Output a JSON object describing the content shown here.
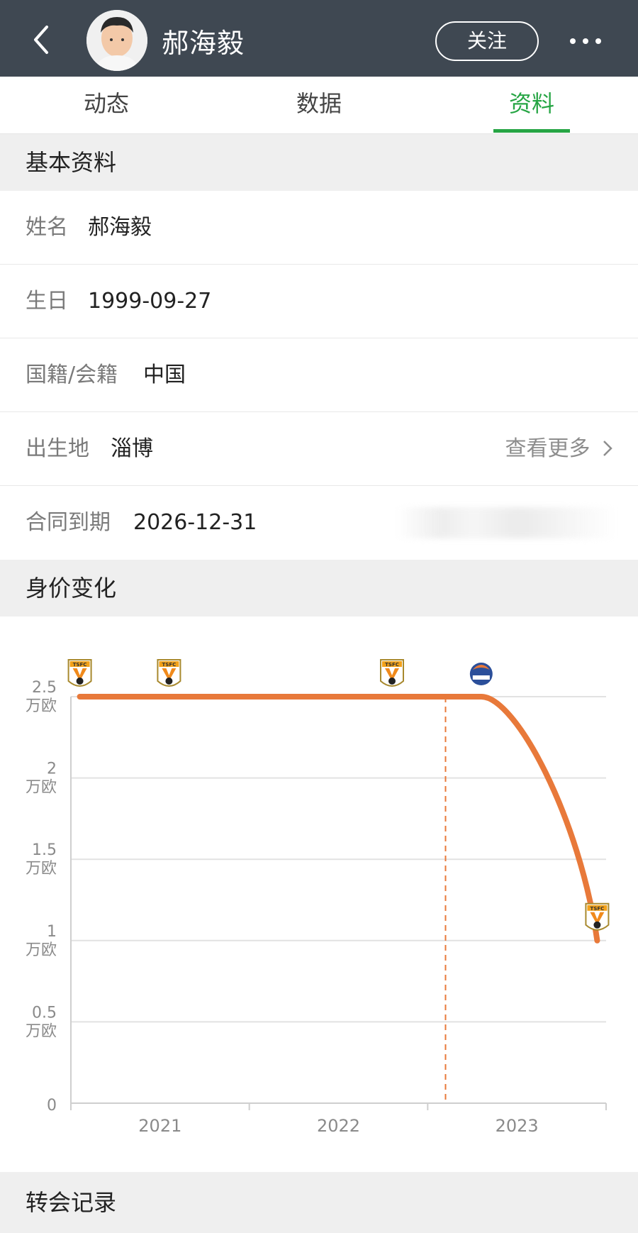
{
  "header": {
    "player_name": "郝海毅",
    "follow_label": "关注"
  },
  "tabs": [
    {
      "label": "动态",
      "active": false
    },
    {
      "label": "数据",
      "active": false
    },
    {
      "label": "资料",
      "active": true
    }
  ],
  "basic_info": {
    "title": "基本资料",
    "rows": [
      {
        "label": "姓名",
        "value": "郝海毅"
      },
      {
        "label": "生日",
        "value": "1999-09-27"
      },
      {
        "label": "国籍/会籍",
        "value": "中国"
      },
      {
        "label": "出生地",
        "value": "淄博",
        "link": "查看更多"
      },
      {
        "label": "合同到期",
        "value": "2026-12-31"
      }
    ]
  },
  "market_value": {
    "title": "身价变化"
  },
  "transfer": {
    "title": "转会记录"
  },
  "colors": {
    "topbar": "#3f4852",
    "accent_green": "#26a544",
    "line_orange": "#e8793a"
  },
  "chart_data": {
    "type": "line",
    "y_ticks": [
      {
        "value": 0,
        "label": "0",
        "unit": ""
      },
      {
        "value": 0.5,
        "label": "0.5",
        "unit": "万欧"
      },
      {
        "value": 1,
        "label": "1",
        "unit": "万欧"
      },
      {
        "value": 1.5,
        "label": "1.5",
        "unit": "万欧"
      },
      {
        "value": 2,
        "label": "2",
        "unit": "万欧"
      },
      {
        "value": 2.5,
        "label": "2.5",
        "unit": "万欧"
      }
    ],
    "x_ticks": [
      "2021",
      "2022",
      "2023"
    ],
    "x_range": [
      2020.5,
      2023.5
    ],
    "ylim": [
      0,
      2.5
    ],
    "series": [
      {
        "values": [
          {
            "x": 2020.55,
            "y": 2.5
          },
          {
            "x": 2021.05,
            "y": 2.5
          },
          {
            "x": 2022.3,
            "y": 2.5
          },
          {
            "x": 2022.8,
            "y": 2.5
          },
          {
            "x": 2023.45,
            "y": 1.0
          }
        ]
      }
    ],
    "club_markers": [
      {
        "x": 2020.55,
        "y": 2.5,
        "club": "TSFC"
      },
      {
        "x": 2021.05,
        "y": 2.5,
        "club": "TSFC"
      },
      {
        "x": 2022.3,
        "y": 2.5,
        "club": "TSFC"
      },
      {
        "x": 2022.8,
        "y": 2.5,
        "club": "BURNEY"
      },
      {
        "x": 2023.45,
        "y": 1.0,
        "club": "TSFC"
      }
    ],
    "vertical_marker_x": 2022.6,
    "grid": true
  }
}
